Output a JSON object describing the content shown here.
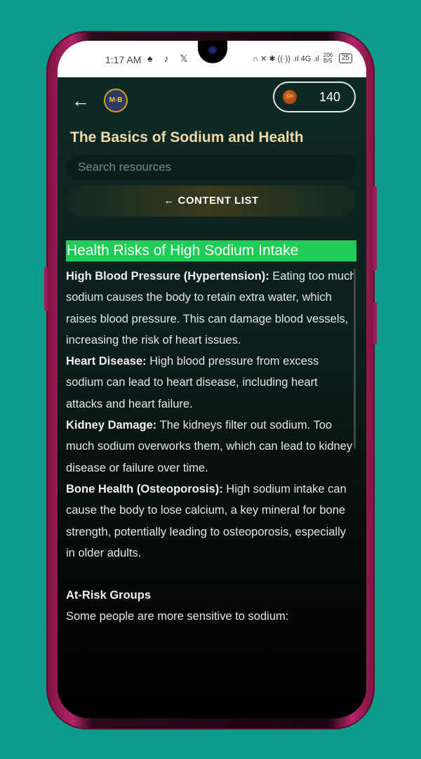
{
  "status_bar": {
    "time": "1:17 AM",
    "app_icons": "♠ ♪ 𝕏",
    "system_icons": "∩ ✕ ✱ ((·)) .ıl 4G .ıl",
    "network_speed": "206 B/S",
    "battery": "25"
  },
  "header": {
    "back_icon": "←",
    "logo_text": "M-B",
    "coin_label": "CH",
    "coin_count": "140"
  },
  "page": {
    "title": "The Basics of Sodium and Health",
    "search_placeholder": "Search resources",
    "content_list_label": "← CONTENT LIST"
  },
  "article": {
    "heading": "Health Risks of High Sodium Intake",
    "items": [
      {
        "term": "High Blood Pressure (Hypertension):",
        "text": " Eating too much sodium causes the body to retain extra water, which raises blood pressure. This can damage blood vessels, increasing the risk of heart issues."
      },
      {
        "term": "Heart Disease:",
        "text": " High blood pressure from excess sodium can lead to heart disease, including heart attacks and heart failure."
      },
      {
        "term": "Kidney Damage:",
        "text": " The kidneys filter out sodium. Too much sodium overworks them, which can lead to kidney disease or failure over time."
      },
      {
        "term": "Bone Health (Osteoporosis):",
        "text": " High sodium intake can cause the body to lose calcium, a key mineral for bone strength, potentially leading to osteoporosis, especially in older adults."
      }
    ],
    "subheading": "At-Risk Groups",
    "subtext": "Some people are more sensitive to sodium:"
  }
}
